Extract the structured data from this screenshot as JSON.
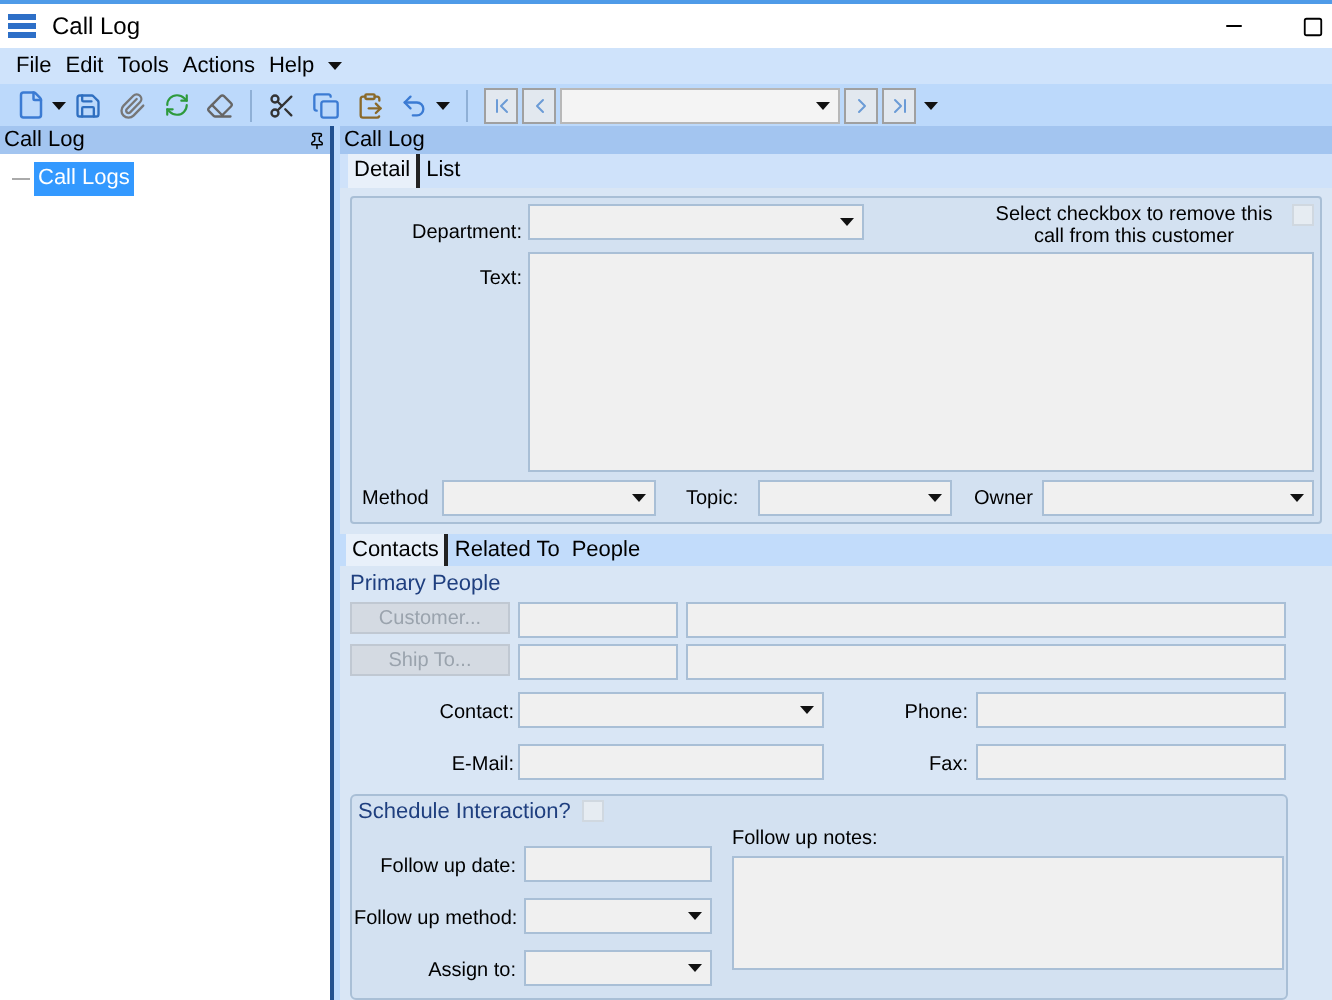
{
  "window": {
    "title": "Call Log"
  },
  "menu": [
    {
      "label": "File"
    },
    {
      "label": "Edit"
    },
    {
      "label": "Tools"
    },
    {
      "label": "Actions"
    },
    {
      "label": "Help"
    }
  ],
  "left_panel": {
    "title": "Call Log",
    "tree": [
      {
        "label": "Call Logs",
        "selected": true
      }
    ]
  },
  "right_panel": {
    "title": "Call Log",
    "tabs": [
      {
        "label": "Detail",
        "selected": true
      },
      {
        "label": "List",
        "selected": false
      }
    ],
    "detail": {
      "department_label": "Department:",
      "text_label": "Text:",
      "remove_note": "Select checkbox to remove this call from this customer",
      "remove_checked": false,
      "method_label": "Method",
      "topic_label": "Topic:",
      "owner_label": "Owner"
    },
    "sub_tabs": [
      {
        "label": "Contacts",
        "selected": true
      },
      {
        "label": "Related To",
        "selected": false
      },
      {
        "label": "People",
        "selected": false
      }
    ],
    "contacts": {
      "group_title": "Primary People",
      "customer_button": {
        "label": "Customer...",
        "disabled": true
      },
      "ship_to_button": {
        "label": "Ship To...",
        "disabled": true
      },
      "contact_label": "Contact:",
      "email_label": "E-Mail:",
      "phone_label": "Phone:",
      "fax_label": "Fax:"
    },
    "schedule": {
      "title": "Schedule Interaction?",
      "checked": false,
      "date_label": "Follow up date:",
      "method_label": "Follow up method:",
      "assign_label": "Assign to:",
      "notes_label": "Follow up notes:"
    }
  }
}
